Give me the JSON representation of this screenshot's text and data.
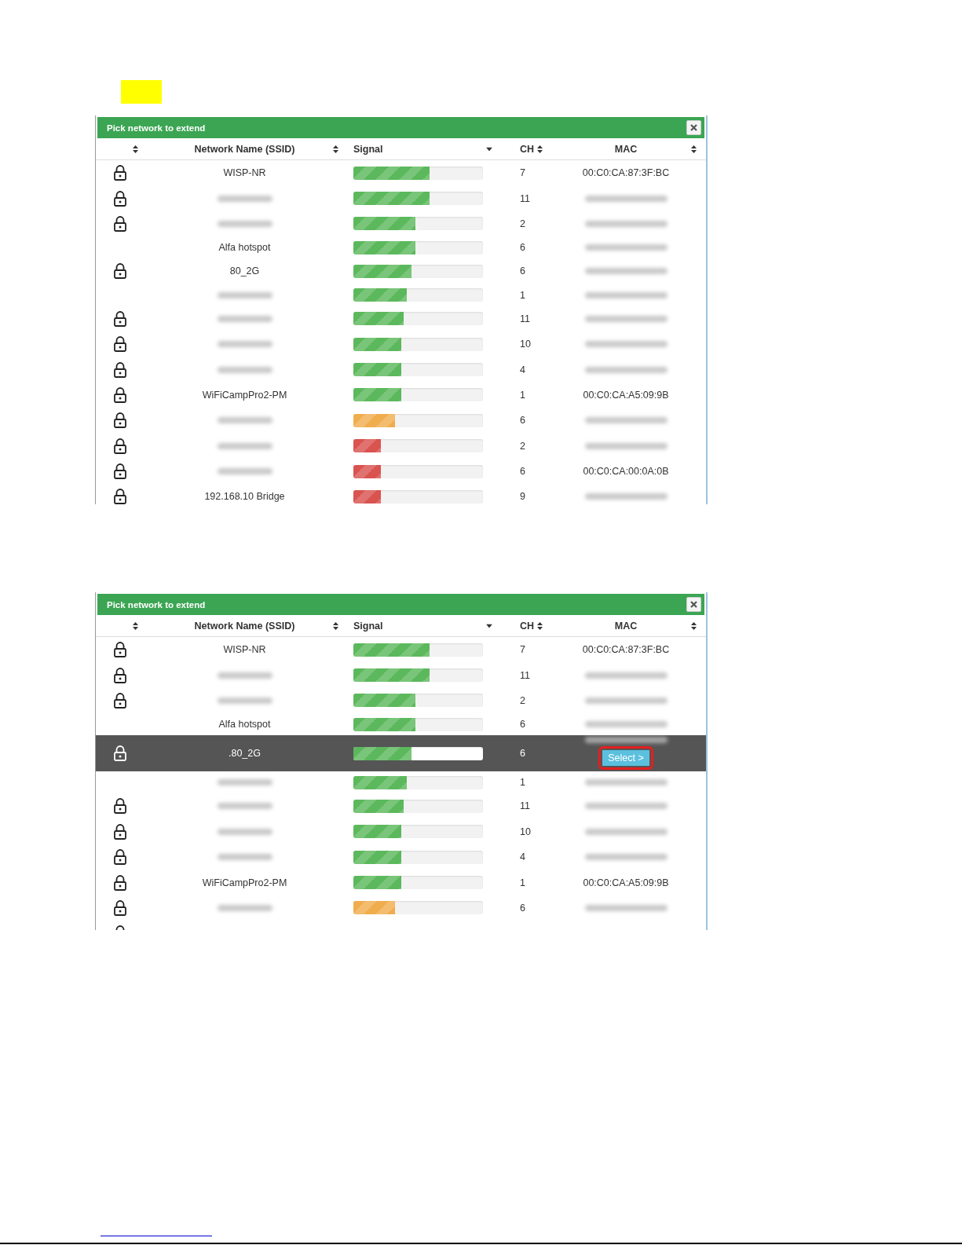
{
  "panels": [
    {
      "title": "Pick network to extend",
      "columns": [
        {
          "sorted": false
        },
        {
          "label": "Network Name (SSID)",
          "sorted": false
        },
        {
          "label": "Signal",
          "sorted": true
        },
        {
          "label": "CH",
          "sorted": false
        },
        {
          "label": "MAC",
          "sorted": false
        }
      ],
      "rows": [
        {
          "locked": true,
          "name": "WISP-NR",
          "level": 0.59,
          "color": "#5cb85c",
          "channel": "7",
          "mac": "00:C0:CA:87:3F:BC",
          "selected": false
        },
        {
          "locked": true,
          "level": 0.59,
          "color": "#5cb85c",
          "channel": "11",
          "selected": false
        },
        {
          "locked": true,
          "level": 0.48,
          "color": "#5cb85c",
          "channel": "2",
          "selected": false
        },
        {
          "locked": false,
          "name": "Alfa hotspot",
          "level": 0.48,
          "color": "#5cb85c",
          "channel": "6",
          "selected": false
        },
        {
          "locked": true,
          "name": "80_2G",
          "level": 0.45,
          "color": "#5cb85c",
          "channel": "6",
          "selected": false
        },
        {
          "locked": false,
          "level": 0.41,
          "color": "#5cb85c",
          "channel": "1",
          "selected": false
        },
        {
          "locked": true,
          "level": 0.39,
          "color": "#5cb85c",
          "channel": "11",
          "selected": false
        },
        {
          "locked": true,
          "level": 0.37,
          "color": "#5cb85c",
          "channel": "10",
          "selected": false
        },
        {
          "locked": true,
          "level": 0.37,
          "color": "#5cb85c",
          "channel": "4",
          "selected": false
        },
        {
          "locked": true,
          "name": "WiFiCampPro2-PM",
          "level": 0.37,
          "color": "#5cb85c",
          "channel": "1",
          "mac": "00:C0:CA:A5:09:9B",
          "selected": false
        },
        {
          "locked": true,
          "level": 0.32,
          "color": "#f0ad4e",
          "channel": "6",
          "selected": false
        },
        {
          "locked": true,
          "level": 0.21,
          "color": "#d9534f",
          "channel": "2",
          "selected": false
        },
        {
          "locked": true,
          "level": 0.21,
          "color": "#d9534f",
          "channel": "6",
          "mac": "00:C0:CA:00:0A:0B",
          "selected": false
        },
        {
          "locked": true,
          "name": "192.168.10 Bridge",
          "level": 0.21,
          "color": "#d9534f",
          "channel": "9",
          "selected": false
        }
      ]
    },
    {
      "title": "Pick network to extend",
      "columns": [
        {
          "sorted": false
        },
        {
          "label": "Network Name (SSID)",
          "sorted": false
        },
        {
          "label": "Signal",
          "sorted": true
        },
        {
          "label": "CH",
          "sorted": false
        },
        {
          "label": "MAC",
          "sorted": false
        }
      ],
      "rows": [
        {
          "locked": true,
          "name": "WISP-NR",
          "level": 0.59,
          "color": "#5cb85c",
          "channel": "7",
          "mac": "00:C0:CA:87:3F:BC",
          "selected": false
        },
        {
          "locked": true,
          "level": 0.59,
          "color": "#5cb85c",
          "channel": "11",
          "selected": false
        },
        {
          "locked": true,
          "level": 0.48,
          "color": "#5cb85c",
          "channel": "2",
          "selected": false
        },
        {
          "locked": false,
          "name": "Alfa hotspot",
          "level": 0.48,
          "color": "#5cb85c",
          "channel": "6",
          "selected": false
        },
        {
          "locked": true,
          "name": ".80_2G",
          "level": 0.45,
          "color": "#5cb85c",
          "channel": "6",
          "selected": true,
          "action": "Select >"
        },
        {
          "locked": false,
          "level": 0.41,
          "color": "#5cb85c",
          "channel": "1",
          "selected": false
        },
        {
          "locked": true,
          "level": 0.39,
          "color": "#5cb85c",
          "channel": "11",
          "selected": false
        },
        {
          "locked": true,
          "level": 0.37,
          "color": "#5cb85c",
          "channel": "10",
          "selected": false
        },
        {
          "locked": true,
          "level": 0.37,
          "color": "#5cb85c",
          "channel": "4",
          "selected": false
        },
        {
          "locked": true,
          "name": "WiFiCampPro2-PM",
          "level": 0.37,
          "color": "#5cb85c",
          "channel": "1",
          "mac": "00:C0:CA:A5:09:9B",
          "selected": false
        },
        {
          "locked": true,
          "level": 0.32,
          "color": "#f0ad4e",
          "channel": "6",
          "selected": false
        },
        {
          "locked": true,
          "selected": false
        }
      ]
    }
  ]
}
